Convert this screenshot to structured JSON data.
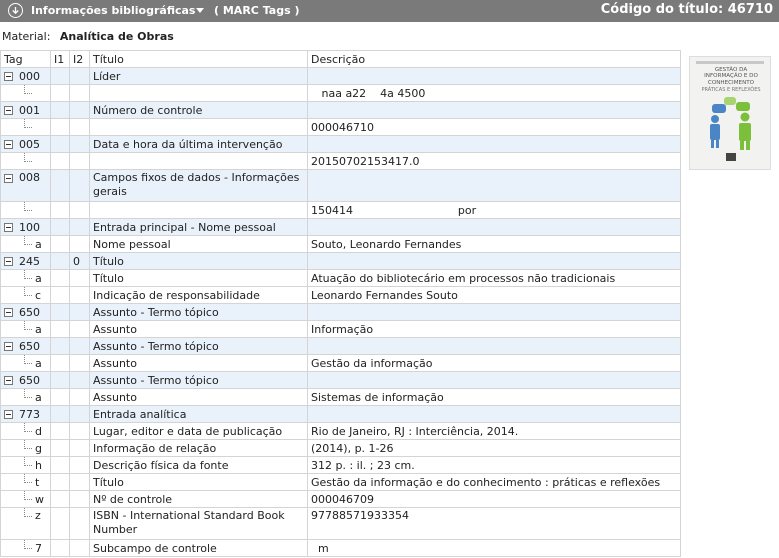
{
  "header": {
    "title": "Informações bibliográficas",
    "tab": "( MARC Tags )",
    "code": "Código do título: 46710"
  },
  "material": {
    "label": "Material:",
    "value": "Analítica de Obras"
  },
  "table": {
    "columns": [
      "Tag",
      "I1",
      "I2",
      "Título",
      "Descrição"
    ],
    "rows": [
      {
        "kind": "parent",
        "tag": "000",
        "i1": "",
        "i2": "",
        "title": "Líder",
        "desc": ""
      },
      {
        "kind": "child",
        "tag": "",
        "i1": "",
        "i2": "",
        "title": "",
        "desc": "   naa a22    4a 4500"
      },
      {
        "kind": "parent",
        "tag": "001",
        "i1": "",
        "i2": "",
        "title": "Número de controle",
        "desc": ""
      },
      {
        "kind": "child",
        "tag": "",
        "i1": "",
        "i2": "",
        "title": "",
        "desc": "000046710"
      },
      {
        "kind": "parent",
        "tag": "005",
        "i1": "",
        "i2": "",
        "title": "Data e hora da última intervenção",
        "desc": ""
      },
      {
        "kind": "child",
        "tag": "",
        "i1": "",
        "i2": "",
        "title": "",
        "desc": "20150702153417.0"
      },
      {
        "kind": "parent",
        "tall": true,
        "tag": "008",
        "i1": "",
        "i2": "",
        "title": "Campos fixos de dados - Informações gerais",
        "desc": ""
      },
      {
        "kind": "child",
        "tag": "",
        "i1": "",
        "i2": "",
        "title": "",
        "desc": "150414                              por"
      },
      {
        "kind": "parent",
        "tag": "100",
        "i1": "",
        "i2": "",
        "title": "Entrada principal - Nome pessoal",
        "desc": ""
      },
      {
        "kind": "child",
        "tag": "a",
        "i1": "",
        "i2": "",
        "title": "Nome pessoal",
        "desc": "Souto, Leonardo Fernandes"
      },
      {
        "kind": "parent",
        "tag": "245",
        "i1": "",
        "i2": "0",
        "title": "Título",
        "desc": ""
      },
      {
        "kind": "child",
        "tag": "a",
        "i1": "",
        "i2": "",
        "title": "Título",
        "desc": "Atuação do bibliotecário em processos não tradicionais"
      },
      {
        "kind": "child",
        "tag": "c",
        "i1": "",
        "i2": "",
        "title": "Indicação de responsabilidade",
        "desc": "Leonardo Fernandes Souto"
      },
      {
        "kind": "parent",
        "tag": "650",
        "i1": "",
        "i2": "",
        "title": "Assunto - Termo tópico",
        "desc": ""
      },
      {
        "kind": "child",
        "tag": "a",
        "i1": "",
        "i2": "",
        "title": "Assunto",
        "desc": "Informação"
      },
      {
        "kind": "parent",
        "tag": "650",
        "i1": "",
        "i2": "",
        "title": "Assunto - Termo tópico",
        "desc": ""
      },
      {
        "kind": "child",
        "tag": "a",
        "i1": "",
        "i2": "",
        "title": "Assunto",
        "desc": "Gestão da informação"
      },
      {
        "kind": "parent",
        "tag": "650",
        "i1": "",
        "i2": "",
        "title": "Assunto - Termo tópico",
        "desc": ""
      },
      {
        "kind": "child",
        "tag": "a",
        "i1": "",
        "i2": "",
        "title": "Assunto",
        "desc": "Sistemas de informação"
      },
      {
        "kind": "parent",
        "tag": "773",
        "i1": "",
        "i2": "",
        "title": "Entrada analítica",
        "desc": ""
      },
      {
        "kind": "child",
        "tag": "d",
        "i1": "",
        "i2": "",
        "title": "Lugar, editor e data de publicação",
        "desc": "Rio de Janeiro, RJ : Interciência, 2014."
      },
      {
        "kind": "child",
        "tag": "g",
        "i1": "",
        "i2": "",
        "title": "Informação de relação",
        "desc": "(2014), p. 1-26"
      },
      {
        "kind": "child",
        "tag": "h",
        "i1": "",
        "i2": "",
        "title": "Descrição física da fonte",
        "desc": "312 p. : il. ; 23 cm."
      },
      {
        "kind": "child",
        "tag": "t",
        "i1": "",
        "i2": "",
        "title": "Título",
        "desc": "Gestão da informação e do conhecimento : práticas e reflexões"
      },
      {
        "kind": "child",
        "tag": "w",
        "i1": "",
        "i2": "",
        "title": "Nº de controle",
        "desc": "000046709"
      },
      {
        "kind": "child",
        "tall": true,
        "tag": "z",
        "i1": "",
        "i2": "",
        "title": "ISBN - International Standard Book Number",
        "desc": "97788571933354"
      },
      {
        "kind": "child",
        "tag": "7",
        "i1": "",
        "i2": "",
        "title": "Subcampo de controle",
        "desc": "  m"
      }
    ]
  },
  "cover": {
    "title": "GESTÃO DA INFORMAÇÃO E DO CONHECIMENTO",
    "subtitle": "PRÁTICAS E REFLEXÕES"
  },
  "colors": {
    "header_bg": "#7a7a7a",
    "parent_row_bg": "#e9f1fa",
    "accent_green": "#7bbf3a",
    "accent_blue": "#4a86c5"
  },
  "icons": {
    "collapse": "arrow-down-circle-icon",
    "dropdown": "caret-down-icon",
    "toggle": "minus-box-icon"
  }
}
